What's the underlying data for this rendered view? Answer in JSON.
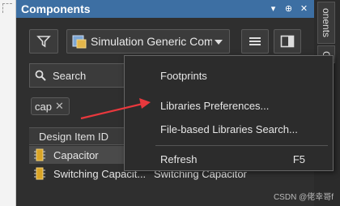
{
  "panel": {
    "title": "Components",
    "title_buttons": [
      "▾",
      "⊕",
      "✕"
    ]
  },
  "toolbar": {
    "library_name": "Simulation Generic Com"
  },
  "search": {
    "value": "Search"
  },
  "filter_chip": {
    "text": "cap",
    "remove": "✕"
  },
  "table": {
    "headers": [
      "Design Item ID"
    ],
    "rows": [
      {
        "id": "Capacitor",
        "desc": ""
      },
      {
        "id": "Switching Capacit...",
        "desc": "Switching Capacitor"
      }
    ]
  },
  "right_tabs": [
    "onents",
    "C"
  ],
  "context_menu": {
    "items": [
      {
        "label": "Footprints",
        "shortcut": ""
      },
      {
        "label": "Libraries Preferences...",
        "shortcut": ""
      },
      {
        "label": "File-based Libraries Search...",
        "shortcut": ""
      },
      {
        "label": "Refresh",
        "shortcut": "F5"
      }
    ]
  },
  "watermark": "CSDN @佬幸哥f",
  "colors": {
    "title_bar": "#3d6fa3",
    "panel_bg": "#2f2f2f",
    "arrow": "#e8383d"
  }
}
